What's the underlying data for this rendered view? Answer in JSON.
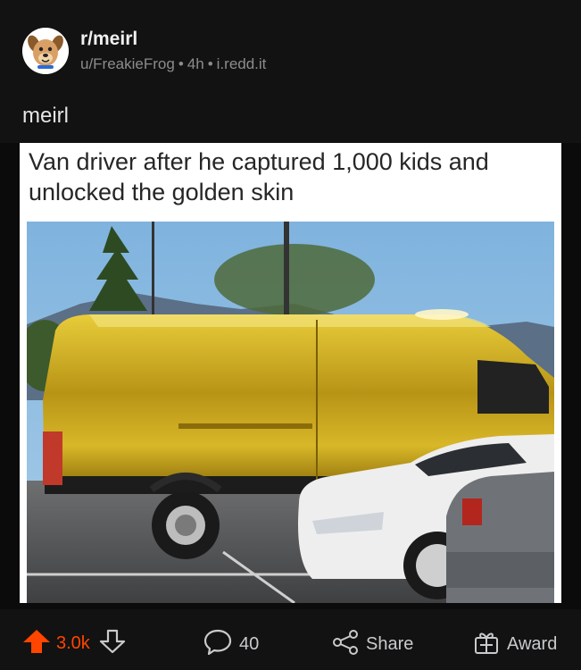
{
  "post": {
    "subreddit": "r/meirl",
    "author": "u/FreakieFrog",
    "age": "4h",
    "domain": "i.redd.it",
    "title": "meirl"
  },
  "media": {
    "caption": "Van driver after he captured 1,000 kids and unlocked the golden skin"
  },
  "actions": {
    "upvotes": "3.0k",
    "comments": "40",
    "share_label": "Share",
    "award_label": "Award"
  },
  "colors": {
    "background": "#0b0b0b",
    "panel": "#121212",
    "upvote_active": "#ff4500",
    "meta_text": "#8a8c8e"
  },
  "icons": [
    "subreddit-avatar-icon",
    "upvote-icon",
    "downvote-icon",
    "comment-icon",
    "share-icon",
    "award-icon"
  ]
}
